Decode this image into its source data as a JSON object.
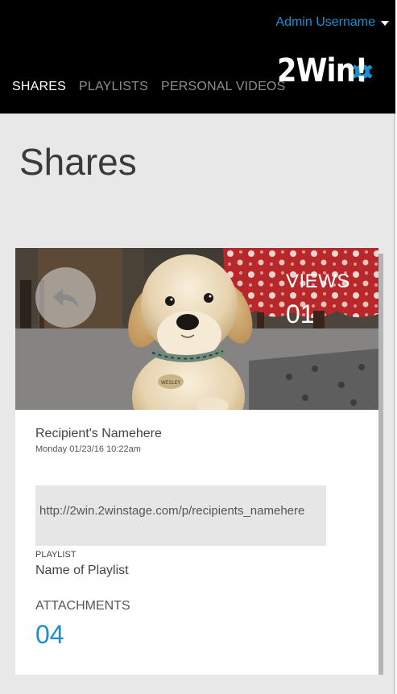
{
  "header": {
    "username": "Admin Username",
    "logo_text": "2Win!",
    "nav": [
      {
        "label": "SHARES"
      },
      {
        "label": "PLAYLISTS"
      },
      {
        "label": "PERSONAL VIDEOS"
      }
    ]
  },
  "page": {
    "title": "Shares"
  },
  "share": {
    "views_label": "VIEWS",
    "views_count": "01",
    "recipient_name": "Recipient's Namehere",
    "date": "Monday 01/23/16 10:22am",
    "link": "http://2win.2winstage.com/p/recipients_namehere",
    "playlist_label": "PLAYLIST",
    "playlist_name": "Name of Playlist",
    "attachments_label": "ATTACHMENTS",
    "attachments_count": "04",
    "tag_text": "WESLEY"
  },
  "colors": {
    "accent": "#1a8fd0",
    "header_bg": "#000000",
    "page_bg": "#e8e8e8"
  },
  "icons": {
    "user_menu": "chevron-down-icon",
    "logo": "gear-icon",
    "back": "reply-arrow-icon"
  }
}
